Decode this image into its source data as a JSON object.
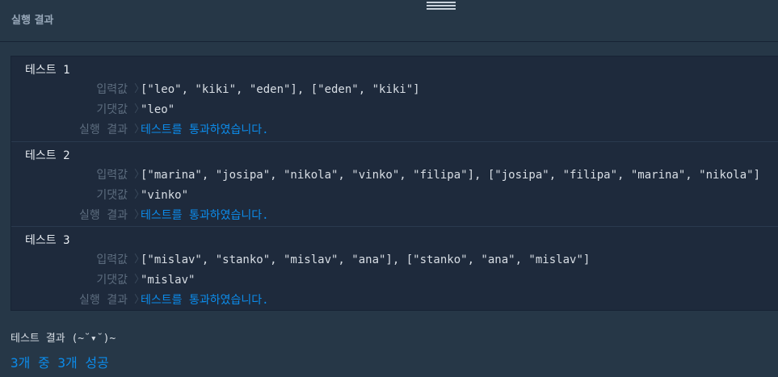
{
  "header": {
    "title": "실행 결과"
  },
  "labels": {
    "input": "입력값",
    "expected": "기댓값",
    "result": "실행 결과",
    "separator": "〉"
  },
  "tests": [
    {
      "title": "테스트 1",
      "input": "[\"leo\", \"kiki\", \"eden\"], [\"eden\", \"kiki\"]",
      "expected": "\"leo\"",
      "result": "테스트를 통과하였습니다."
    },
    {
      "title": "테스트 2",
      "input": "[\"marina\", \"josipa\", \"nikola\", \"vinko\", \"filipa\"], [\"josipa\", \"filipa\", \"marina\", \"nikola\"]",
      "expected": "\"vinko\"",
      "result": "테스트를 통과하였습니다."
    },
    {
      "title": "테스트 3",
      "input": "[\"mislav\", \"stanko\", \"mislav\", \"ana\"], [\"stanko\", \"ana\", \"mislav\"]",
      "expected": "\"mislav\"",
      "result": "테스트를 통과하였습니다."
    }
  ],
  "summary": {
    "title": "테스트 결과 (~˘▾˘)~",
    "count": "3개 중 3개 성공"
  },
  "colors": {
    "background": "#263747",
    "panel": "#1e2a3c",
    "pass": "#0c8ceb",
    "label": "#5d6d7f"
  }
}
